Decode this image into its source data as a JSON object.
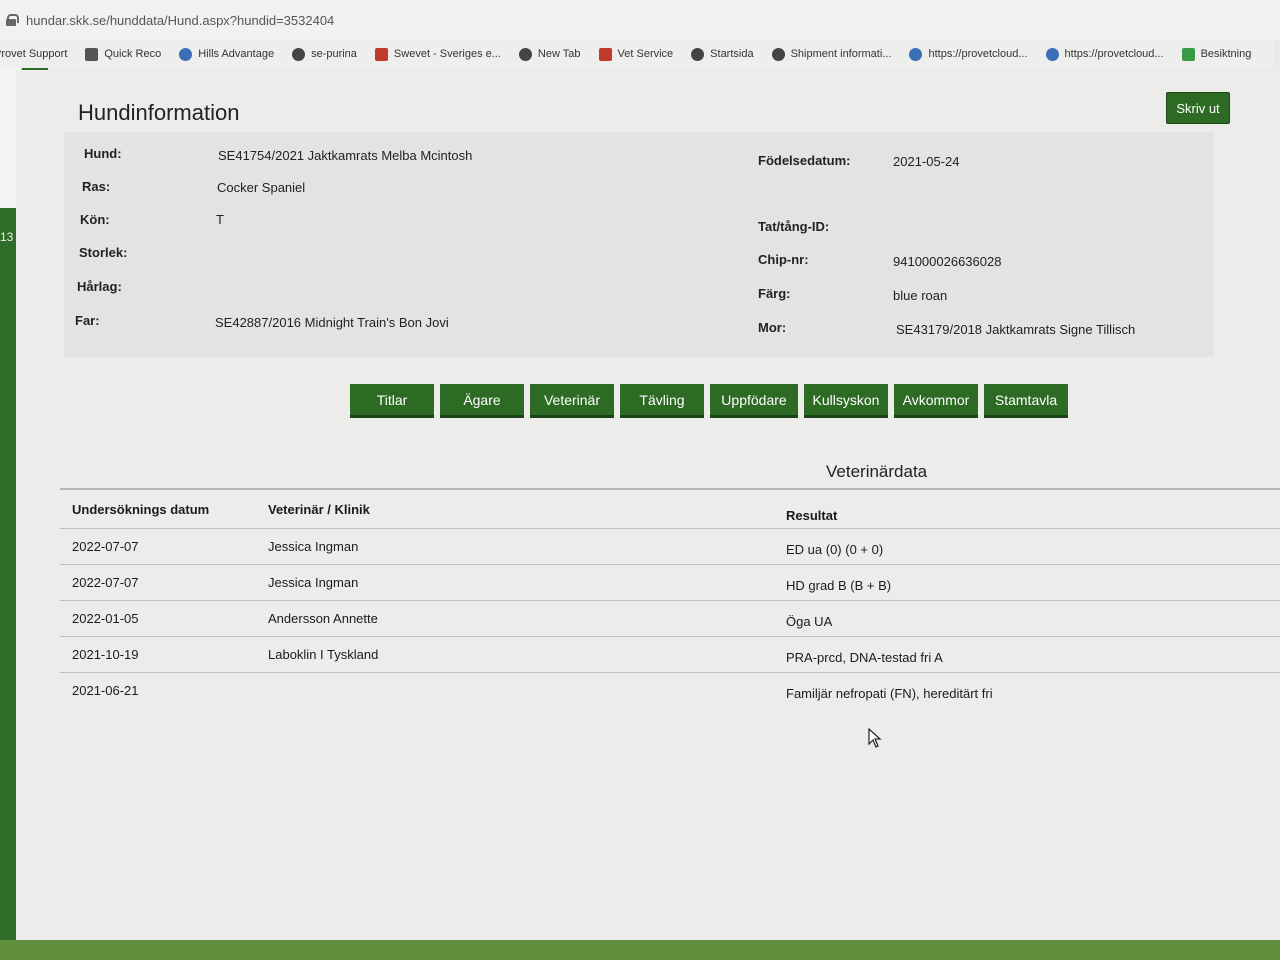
{
  "browser": {
    "url": "hundar.skk.se/hunddata/Hund.aspx?hundid=3532404",
    "bookmarks": [
      {
        "label": "Provet Support",
        "icon": "none"
      },
      {
        "label": "Quick Reco",
        "icon": "sq"
      },
      {
        "label": "Hills Advantage",
        "icon": "blue"
      },
      {
        "label": "se-purina",
        "icon": "globe"
      },
      {
        "label": "Swevet - Sveriges e...",
        "icon": "red"
      },
      {
        "label": "New Tab",
        "icon": "globe"
      },
      {
        "label": "Vet Service",
        "icon": "red"
      },
      {
        "label": "Startsida",
        "icon": "globe"
      },
      {
        "label": "Shipment informati...",
        "icon": "globe"
      },
      {
        "label": "https://provetcloud...",
        "icon": "blue"
      },
      {
        "label": "https://provetcloud...",
        "icon": "blue"
      },
      {
        "label": "Besiktning",
        "icon": "green"
      }
    ]
  },
  "leftrail": {
    "number": "13"
  },
  "page": {
    "title": "Hundinformation",
    "print_label": "Skriv ut"
  },
  "dog": {
    "hund_label": "Hund:",
    "hund_value": "SE41754/2021 Jaktkamrats Melba Mcintosh",
    "ras_label": "Ras:",
    "ras_value": "Cocker Spaniel",
    "kon_label": "Kön:",
    "kon_value": "T",
    "storlek_label": "Storlek:",
    "harlag_label": "Hårlag:",
    "far_label": "Far:",
    "far_value": "SE42887/2016 Midnight Train's Bon Jovi",
    "fodelse_label": "Födelsedatum:",
    "fodelse_value": "2021-05-24",
    "tat_label": "Tat/tång-ID:",
    "chip_label": "Chip-nr:",
    "chip_value": "941000026636028",
    "farg_label": "Färg:",
    "farg_value": "blue roan",
    "mor_label": "Mor:",
    "mor_value": "SE43179/2018 Jaktkamrats Signe Tillisch"
  },
  "tabs": [
    "Titlar",
    "Ägare",
    "Veterinär",
    "Tävling",
    "Uppfödare",
    "Kullsyskon",
    "Avkommor",
    "Stamtavla"
  ],
  "vet": {
    "title": "Veterinärdata",
    "headers": {
      "date": "Undersöknings datum",
      "vet": "Veterinär / Klinik",
      "result": "Resultat"
    },
    "rows": [
      {
        "date": "2022-07-07",
        "vet": "Jessica Ingman",
        "result": "ED ua (0) (0 + 0)"
      },
      {
        "date": "2022-07-07",
        "vet": "Jessica Ingman",
        "result": "HD grad B (B + B)"
      },
      {
        "date": "2022-01-05",
        "vet": "Andersson Annette",
        "result": "Öga UA"
      },
      {
        "date": "2021-10-19",
        "vet": "Laboklin I Tyskland",
        "result": "PRA-prcd, DNA-testad fri A"
      },
      {
        "date": "2021-06-21",
        "vet": "",
        "result": "Familjär nefropati (FN), hereditärt fri"
      }
    ]
  }
}
